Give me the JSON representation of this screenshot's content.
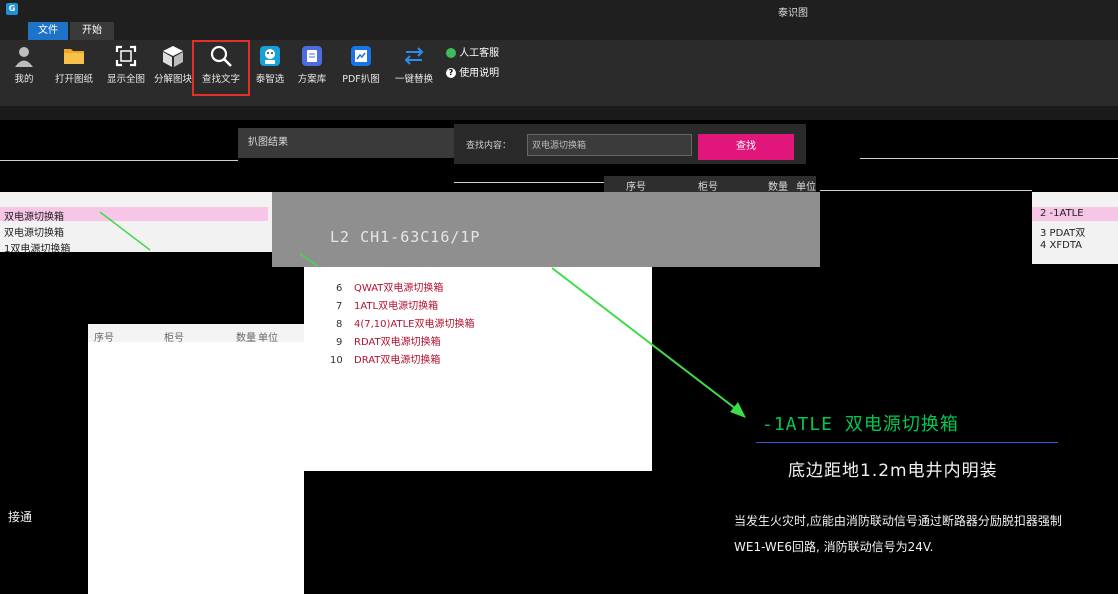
{
  "window": {
    "title": "泰识图",
    "app_icon": "G"
  },
  "menu": {
    "tabs": [
      "文件",
      "开始"
    ]
  },
  "ribbon": {
    "buttons": [
      {
        "label": "我的",
        "icon": "user-icon"
      },
      {
        "label": "打开图纸",
        "icon": "folder-icon"
      },
      {
        "label": "显示全图",
        "icon": "fit-view-icon"
      },
      {
        "label": "分解图块",
        "icon": "cube-icon"
      },
      {
        "label": "查找文字",
        "icon": "search-icon"
      },
      {
        "label": "泰智选",
        "icon": "robot-icon"
      },
      {
        "label": "方案库",
        "icon": "library-icon"
      },
      {
        "label": "PDF扒图",
        "icon": "pdf-icon"
      },
      {
        "label": "一键替换",
        "icon": "swap-icon"
      }
    ],
    "help": {
      "service": "人工客服",
      "manual": "使用说明"
    }
  },
  "result_panel": {
    "title": "扒图结果"
  },
  "search": {
    "label": "查找内容：",
    "placeholder": "双电源切换箱",
    "button": "查找"
  },
  "table_header": {
    "col1": "序号",
    "col2": "柜号",
    "col3": "数量",
    "col4": "单位"
  },
  "left_list": [
    "双电源切换箱",
    "双电源切换箱",
    "1双电源切换箱"
  ],
  "preview_text": "L2     CH1-63C16/1P",
  "right_list": [
    "2  -1ATLE",
    "3  PDAT双",
    "4  XFDTA"
  ],
  "results": [
    {
      "num": "6",
      "text": "QWAT双电源切换箱"
    },
    {
      "num": "7",
      "text": "1ATL双电源切换箱"
    },
    {
      "num": "8",
      "text": "4(7,10)ATLE双电源切换箱"
    },
    {
      "num": "9",
      "text": "RDAT双电源切换箱"
    },
    {
      "num": "10",
      "text": "DRAT双电源切换箱"
    }
  ],
  "table_panel": {
    "col1": "序号",
    "col2": "柜号",
    "col3": "数量",
    "col4": "单位"
  },
  "canvas": {
    "ann1": "-1ATLE 双电源切换箱",
    "ann2": "底边距地1.2m电井内明装",
    "ann3": "当发生火灾时,应能由消防联动信号通过断路器分励脱扣器强制",
    "ann4": "WE1-WE6回路, 消防联动信号为24V.",
    "ann5": "接通"
  },
  "colors": {
    "accent": "#1e73c8",
    "search_button": "#e0167b",
    "highlight": "#e0302a",
    "green_text": "#00c853"
  }
}
